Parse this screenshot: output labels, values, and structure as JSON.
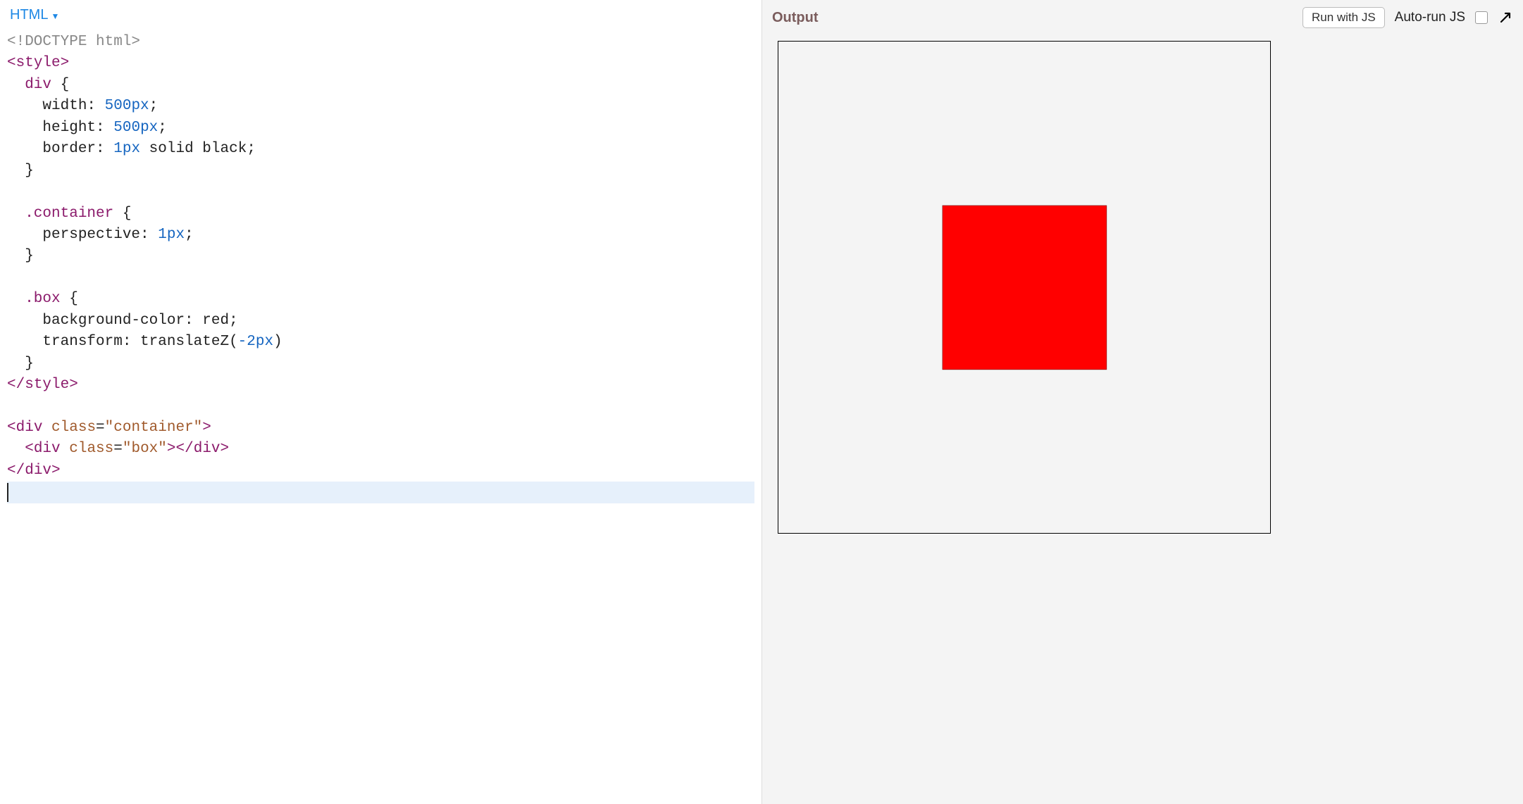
{
  "editor": {
    "language_label": "HTML",
    "code_tokens": [
      [
        [
          "<!DOCTYPE html>",
          "tok-doctype"
        ]
      ],
      [
        [
          "<",
          "tok-angle"
        ],
        [
          "style",
          "tok-tag"
        ],
        [
          ">",
          "tok-angle"
        ]
      ],
      [
        [
          "  div ",
          "tok-sel"
        ],
        [
          "{",
          "tok-punct"
        ]
      ],
      [
        [
          "    width",
          "tok-prop"
        ],
        [
          ": ",
          "tok-punct"
        ],
        [
          "500",
          "tok-num"
        ],
        [
          "px",
          "tok-unit"
        ],
        [
          ";",
          "tok-punct"
        ]
      ],
      [
        [
          "    height",
          "tok-prop"
        ],
        [
          ": ",
          "tok-punct"
        ],
        [
          "500",
          "tok-num"
        ],
        [
          "px",
          "tok-unit"
        ],
        [
          ";",
          "tok-punct"
        ]
      ],
      [
        [
          "    border",
          "tok-prop"
        ],
        [
          ": ",
          "tok-punct"
        ],
        [
          "1",
          "tok-num"
        ],
        [
          "px",
          "tok-unit"
        ],
        [
          " solid black",
          "tok-val"
        ],
        [
          ";",
          "tok-punct"
        ]
      ],
      [
        [
          "  }",
          "tok-punct"
        ]
      ],
      [
        [
          "",
          ""
        ]
      ],
      [
        [
          "  .container ",
          "tok-sel"
        ],
        [
          "{",
          "tok-punct"
        ]
      ],
      [
        [
          "    perspective",
          "tok-prop"
        ],
        [
          ": ",
          "tok-punct"
        ],
        [
          "1",
          "tok-num"
        ],
        [
          "px",
          "tok-unit"
        ],
        [
          ";",
          "tok-punct"
        ]
      ],
      [
        [
          "  }",
          "tok-punct"
        ]
      ],
      [
        [
          "",
          ""
        ]
      ],
      [
        [
          "  .box ",
          "tok-sel"
        ],
        [
          "{",
          "tok-punct"
        ]
      ],
      [
        [
          "    background-color",
          "tok-prop"
        ],
        [
          ": ",
          "tok-punct"
        ],
        [
          "red",
          "tok-val"
        ],
        [
          ";",
          "tok-punct"
        ]
      ],
      [
        [
          "    transform",
          "tok-prop"
        ],
        [
          ": ",
          "tok-punct"
        ],
        [
          "translateZ(",
          "tok-val"
        ],
        [
          "-2",
          "tok-num"
        ],
        [
          "px",
          "tok-unit"
        ],
        [
          ")",
          "tok-val"
        ]
      ],
      [
        [
          "  }",
          "tok-punct"
        ]
      ],
      [
        [
          "</",
          "tok-angle"
        ],
        [
          "style",
          "tok-tag"
        ],
        [
          ">",
          "tok-angle"
        ]
      ],
      [
        [
          "",
          ""
        ]
      ],
      [
        [
          "<",
          "tok-angle"
        ],
        [
          "div",
          "tok-tag"
        ],
        [
          " ",
          ""
        ],
        [
          "class",
          "tok-attr"
        ],
        [
          "=",
          "tok-punct"
        ],
        [
          "\"container\"",
          "tok-str"
        ],
        [
          ">",
          "tok-angle"
        ]
      ],
      [
        [
          "  ",
          ""
        ],
        [
          "<",
          "tok-angle"
        ],
        [
          "div",
          "tok-tag"
        ],
        [
          " ",
          ""
        ],
        [
          "class",
          "tok-attr"
        ],
        [
          "=",
          "tok-punct"
        ],
        [
          "\"box\"",
          "tok-str"
        ],
        [
          ">",
          "tok-angle"
        ],
        [
          "</",
          "tok-angle"
        ],
        [
          "div",
          "tok-tag"
        ],
        [
          ">",
          "tok-angle"
        ]
      ],
      [
        [
          "</",
          "tok-angle"
        ],
        [
          "div",
          "tok-tag"
        ],
        [
          ">",
          "tok-angle"
        ]
      ]
    ],
    "cursor_line_index": 21
  },
  "output": {
    "title": "Output",
    "run_button_label": "Run with JS",
    "autorun_label": "Auto-run JS",
    "autorun_checked": false,
    "box_color": "red"
  }
}
